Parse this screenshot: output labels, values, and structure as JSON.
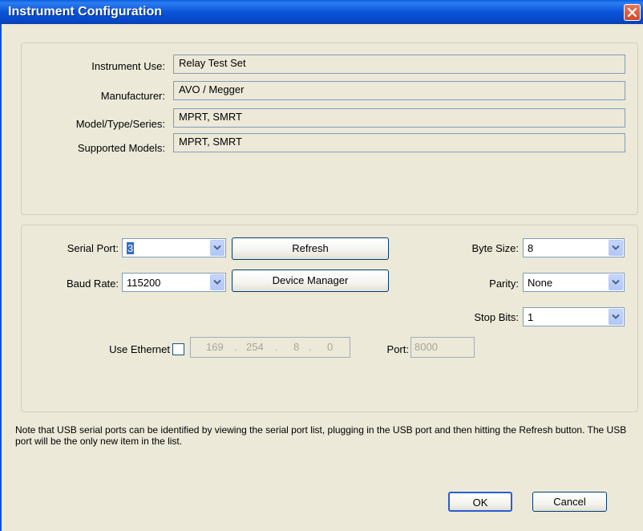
{
  "window": {
    "title": "Instrument Configuration"
  },
  "instrument": {
    "use_label": "Instrument Use:",
    "use_value": "Relay Test Set",
    "manufacturer_label": "Manufacturer:",
    "manufacturer_value": "AVO / Megger",
    "model_label": "Model/Type/Series:",
    "model_value": "MPRT, SMRT",
    "supported_label": "Supported Models:",
    "supported_value": "MPRT, SMRT"
  },
  "comm": {
    "serial_port_label": "Serial Port:",
    "serial_port_value": "3",
    "baud_rate_label": "Baud Rate:",
    "baud_rate_value": "115200",
    "refresh_label": "Refresh",
    "device_manager_label": "Device Manager",
    "byte_size_label": "Byte Size:",
    "byte_size_value": "8",
    "parity_label": "Parity:",
    "parity_value": "None",
    "stop_bits_label": "Stop Bits:",
    "stop_bits_value": "1",
    "use_ethernet_label": "Use Ethernet",
    "use_ethernet_checked": false,
    "ip": [
      "169",
      "254",
      "8",
      "0"
    ],
    "ip_dot": ".",
    "port_label": "Port:",
    "port_value": "8000"
  },
  "note": "Note that USB serial ports can be identified by viewing the serial port list, plugging in the USB port and then hitting the Refresh button.  The USB port will be the only new item in the list.",
  "buttons": {
    "ok": "OK",
    "cancel": "Cancel"
  },
  "icons": {
    "close": "close-icon",
    "dropdown": "chevron-down-icon"
  },
  "colors": {
    "titlebar": "#0a54d8",
    "dialog_bg": "#ece9d8",
    "selection": "#316ac5",
    "close_button": "#d24a24"
  }
}
